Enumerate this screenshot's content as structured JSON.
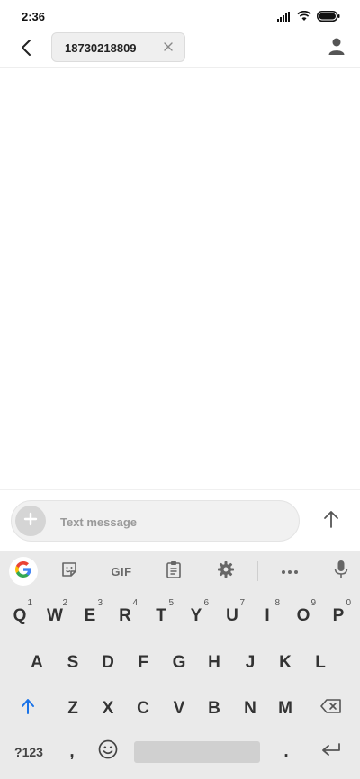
{
  "status": {
    "time": "2:36"
  },
  "header": {
    "recipient": "18730218809"
  },
  "compose": {
    "placeholder": "Text message"
  },
  "keyboard": {
    "toolbar": {
      "gif_label": "GIF"
    },
    "row1": [
      {
        "label": "Q",
        "hint": "1"
      },
      {
        "label": "W",
        "hint": "2"
      },
      {
        "label": "E",
        "hint": "3"
      },
      {
        "label": "R",
        "hint": "4"
      },
      {
        "label": "T",
        "hint": "5"
      },
      {
        "label": "Y",
        "hint": "6"
      },
      {
        "label": "U",
        "hint": "7"
      },
      {
        "label": "I",
        "hint": "8"
      },
      {
        "label": "O",
        "hint": "9"
      },
      {
        "label": "P",
        "hint": "0"
      }
    ],
    "row2": [
      "A",
      "S",
      "D",
      "F",
      "G",
      "H",
      "J",
      "K",
      "L"
    ],
    "row3": [
      "Z",
      "X",
      "C",
      "V",
      "B",
      "N",
      "M"
    ],
    "symbols_label": "?123",
    "comma_label": ",",
    "period_label": "."
  },
  "colors": {
    "shift_accent": "#1a73e8",
    "keyboard_bg": "#eaeaea"
  }
}
